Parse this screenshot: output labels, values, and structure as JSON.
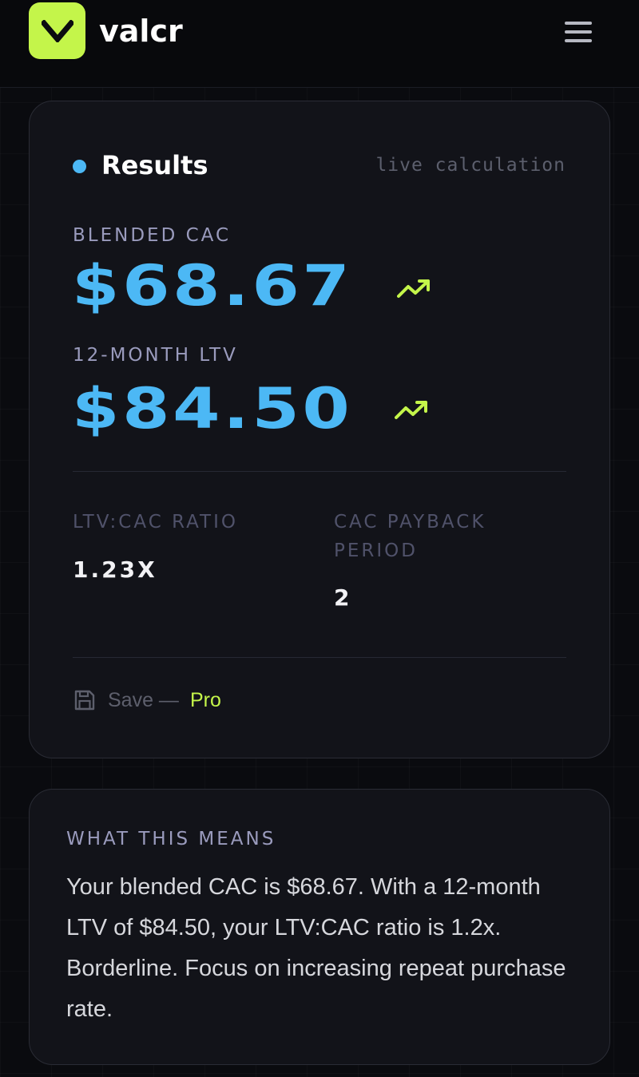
{
  "header": {
    "logo_letter": "v",
    "brand": "valcr",
    "menu_icon": "hamburger-menu-icon"
  },
  "results": {
    "title": "Results",
    "status": "live calculation",
    "blended_cac_label": "BLENDED CAC",
    "blended_cac_value": "$68.67",
    "ltv_label": "12-MONTH LTV",
    "ltv_value": "$84.50",
    "trend_icon": "trending-up-icon",
    "ratio_label": "LTV:CAC RATIO",
    "ratio_value": "1.23X",
    "payback_label": "CAC PAYBACK PERIOD",
    "payback_value": "2",
    "save_label": "Save —",
    "save_pro": "Pro",
    "save_icon": "floppy-disk-icon"
  },
  "meaning": {
    "title": "WHAT THIS MEANS",
    "body": "Your blended CAC is $68.67. With a 12-month LTV of $84.50, your LTV:CAC ratio is 1.2x. Borderline. Focus on increasing repeat purchase rate."
  },
  "colors": {
    "accent_lime": "#c4f54a",
    "accent_blue": "#4cb8f5",
    "background": "#0a0b0f",
    "card": "#121319"
  }
}
